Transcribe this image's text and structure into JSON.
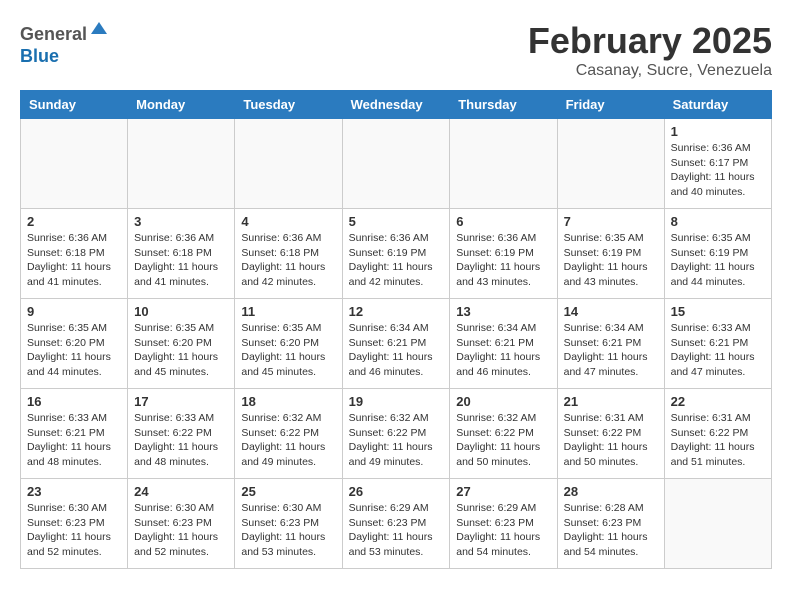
{
  "header": {
    "logo_line1": "General",
    "logo_line2": "Blue",
    "month": "February 2025",
    "location": "Casanay, Sucre, Venezuela"
  },
  "weekdays": [
    "Sunday",
    "Monday",
    "Tuesday",
    "Wednesday",
    "Thursday",
    "Friday",
    "Saturday"
  ],
  "weeks": [
    [
      {
        "day": "",
        "info": ""
      },
      {
        "day": "",
        "info": ""
      },
      {
        "day": "",
        "info": ""
      },
      {
        "day": "",
        "info": ""
      },
      {
        "day": "",
        "info": ""
      },
      {
        "day": "",
        "info": ""
      },
      {
        "day": "1",
        "info": "Sunrise: 6:36 AM\nSunset: 6:17 PM\nDaylight: 11 hours\nand 40 minutes."
      }
    ],
    [
      {
        "day": "2",
        "info": "Sunrise: 6:36 AM\nSunset: 6:18 PM\nDaylight: 11 hours\nand 41 minutes."
      },
      {
        "day": "3",
        "info": "Sunrise: 6:36 AM\nSunset: 6:18 PM\nDaylight: 11 hours\nand 41 minutes."
      },
      {
        "day": "4",
        "info": "Sunrise: 6:36 AM\nSunset: 6:18 PM\nDaylight: 11 hours\nand 42 minutes."
      },
      {
        "day": "5",
        "info": "Sunrise: 6:36 AM\nSunset: 6:19 PM\nDaylight: 11 hours\nand 42 minutes."
      },
      {
        "day": "6",
        "info": "Sunrise: 6:36 AM\nSunset: 6:19 PM\nDaylight: 11 hours\nand 43 minutes."
      },
      {
        "day": "7",
        "info": "Sunrise: 6:35 AM\nSunset: 6:19 PM\nDaylight: 11 hours\nand 43 minutes."
      },
      {
        "day": "8",
        "info": "Sunrise: 6:35 AM\nSunset: 6:19 PM\nDaylight: 11 hours\nand 44 minutes."
      }
    ],
    [
      {
        "day": "9",
        "info": "Sunrise: 6:35 AM\nSunset: 6:20 PM\nDaylight: 11 hours\nand 44 minutes."
      },
      {
        "day": "10",
        "info": "Sunrise: 6:35 AM\nSunset: 6:20 PM\nDaylight: 11 hours\nand 45 minutes."
      },
      {
        "day": "11",
        "info": "Sunrise: 6:35 AM\nSunset: 6:20 PM\nDaylight: 11 hours\nand 45 minutes."
      },
      {
        "day": "12",
        "info": "Sunrise: 6:34 AM\nSunset: 6:21 PM\nDaylight: 11 hours\nand 46 minutes."
      },
      {
        "day": "13",
        "info": "Sunrise: 6:34 AM\nSunset: 6:21 PM\nDaylight: 11 hours\nand 46 minutes."
      },
      {
        "day": "14",
        "info": "Sunrise: 6:34 AM\nSunset: 6:21 PM\nDaylight: 11 hours\nand 47 minutes."
      },
      {
        "day": "15",
        "info": "Sunrise: 6:33 AM\nSunset: 6:21 PM\nDaylight: 11 hours\nand 47 minutes."
      }
    ],
    [
      {
        "day": "16",
        "info": "Sunrise: 6:33 AM\nSunset: 6:21 PM\nDaylight: 11 hours\nand 48 minutes."
      },
      {
        "day": "17",
        "info": "Sunrise: 6:33 AM\nSunset: 6:22 PM\nDaylight: 11 hours\nand 48 minutes."
      },
      {
        "day": "18",
        "info": "Sunrise: 6:32 AM\nSunset: 6:22 PM\nDaylight: 11 hours\nand 49 minutes."
      },
      {
        "day": "19",
        "info": "Sunrise: 6:32 AM\nSunset: 6:22 PM\nDaylight: 11 hours\nand 49 minutes."
      },
      {
        "day": "20",
        "info": "Sunrise: 6:32 AM\nSunset: 6:22 PM\nDaylight: 11 hours\nand 50 minutes."
      },
      {
        "day": "21",
        "info": "Sunrise: 6:31 AM\nSunset: 6:22 PM\nDaylight: 11 hours\nand 50 minutes."
      },
      {
        "day": "22",
        "info": "Sunrise: 6:31 AM\nSunset: 6:22 PM\nDaylight: 11 hours\nand 51 minutes."
      }
    ],
    [
      {
        "day": "23",
        "info": "Sunrise: 6:30 AM\nSunset: 6:23 PM\nDaylight: 11 hours\nand 52 minutes."
      },
      {
        "day": "24",
        "info": "Sunrise: 6:30 AM\nSunset: 6:23 PM\nDaylight: 11 hours\nand 52 minutes."
      },
      {
        "day": "25",
        "info": "Sunrise: 6:30 AM\nSunset: 6:23 PM\nDaylight: 11 hours\nand 53 minutes."
      },
      {
        "day": "26",
        "info": "Sunrise: 6:29 AM\nSunset: 6:23 PM\nDaylight: 11 hours\nand 53 minutes."
      },
      {
        "day": "27",
        "info": "Sunrise: 6:29 AM\nSunset: 6:23 PM\nDaylight: 11 hours\nand 54 minutes."
      },
      {
        "day": "28",
        "info": "Sunrise: 6:28 AM\nSunset: 6:23 PM\nDaylight: 11 hours\nand 54 minutes."
      },
      {
        "day": "",
        "info": ""
      }
    ]
  ]
}
